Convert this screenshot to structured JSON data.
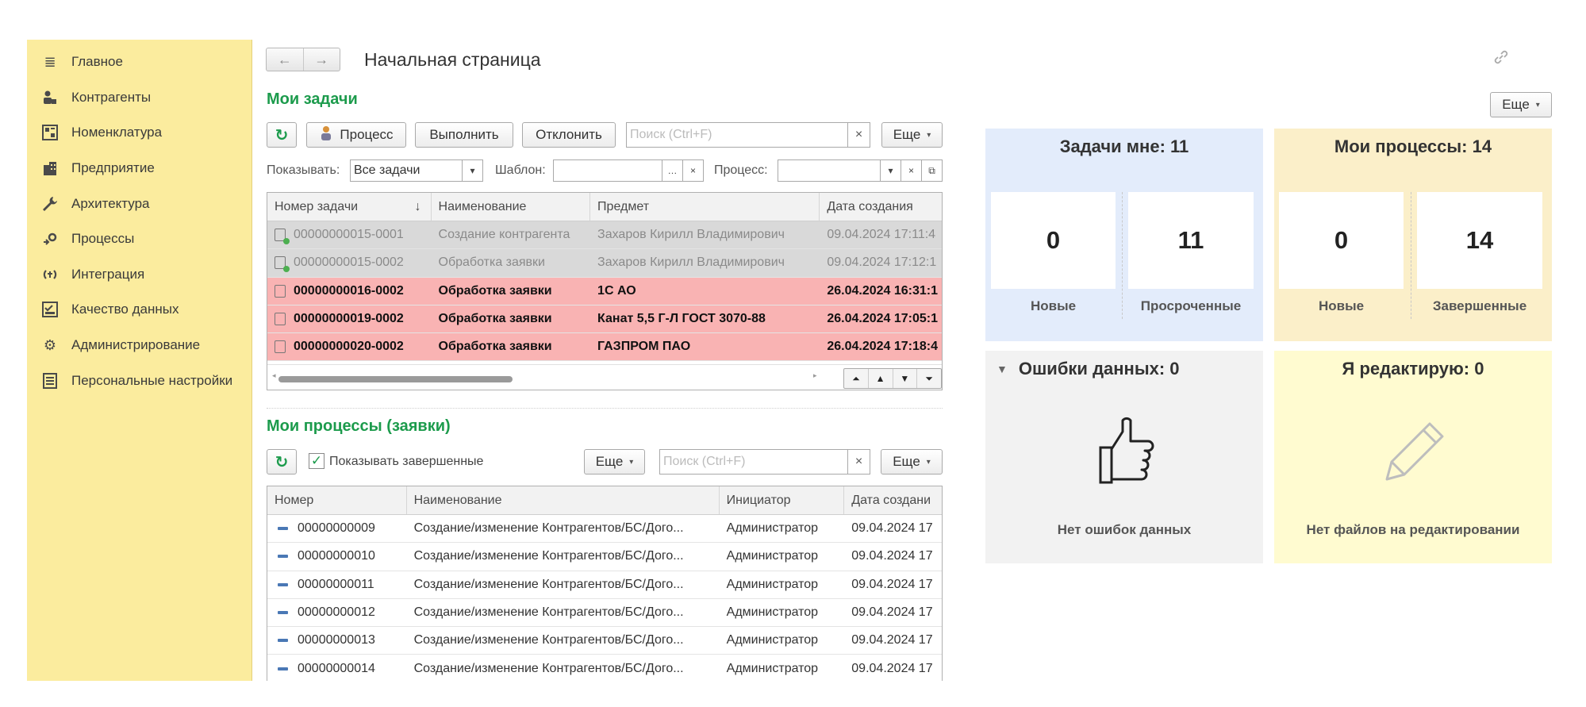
{
  "sidebar": {
    "items": [
      {
        "label": "Главное",
        "icon": "menu-lines-icon"
      },
      {
        "label": "Контрагенты",
        "icon": "people-icon"
      },
      {
        "label": "Номенклатура",
        "icon": "catalog-icon"
      },
      {
        "label": "Предприятие",
        "icon": "building-icon"
      },
      {
        "label": "Архитектура",
        "icon": "wrench-icon"
      },
      {
        "label": "Процессы",
        "icon": "process-icon"
      },
      {
        "label": "Интеграция",
        "icon": "sync-icon"
      },
      {
        "label": "Качество данных",
        "icon": "quality-icon"
      },
      {
        "label": "Администрирование",
        "icon": "gear-icon"
      },
      {
        "label": "Персональные настройки",
        "icon": "settings-list-icon"
      }
    ]
  },
  "header": {
    "title": "Начальная страница"
  },
  "tasks": {
    "title": "Мои задачи",
    "process_btn": "Процесс",
    "execute_btn": "Выполнить",
    "reject_btn": "Отклонить",
    "search_placeholder": "Поиск (Ctrl+F)",
    "more_btn": "Еще",
    "filter": {
      "show_label": "Показывать:",
      "show_value": "Все задачи",
      "template_label": "Шаблон:",
      "template_value": "",
      "process_label": "Процесс:",
      "process_value": ""
    },
    "columns": [
      "Номер задачи",
      "Наименование",
      "Предмет",
      "Дата создания"
    ],
    "rows": [
      {
        "style": "gray",
        "number": "00000000015-0001",
        "name": "Создание контрагента",
        "subject": "Захаров Кирилл Владимирович",
        "date": "09.04.2024 17:11:4"
      },
      {
        "style": "gray",
        "number": "00000000015-0002",
        "name": "Обработка заявки",
        "subject": "Захаров Кирилл Владимирович",
        "date": "09.04.2024 17:12:1"
      },
      {
        "style": "red",
        "number": "00000000016-0002",
        "name": "Обработка заявки",
        "subject": "1С АО",
        "date": "26.04.2024 16:31:1"
      },
      {
        "style": "red",
        "number": "00000000019-0002",
        "name": "Обработка заявки",
        "subject": "Канат 5,5 Г-Л ГОСТ 3070-88",
        "date": "26.04.2024 17:05:1"
      },
      {
        "style": "red",
        "number": "00000000020-0002",
        "name": "Обработка заявки",
        "subject": "ГАЗПРОМ ПАО",
        "date": "26.04.2024 17:18:4"
      }
    ]
  },
  "processes": {
    "title": "Мои процессы (заявки)",
    "show_completed_label": "Показывать завершенные",
    "show_completed_checked": true,
    "more_btn": "Еще",
    "search_placeholder": "Поиск (Ctrl+F)",
    "more_btn2": "Еще",
    "columns": [
      "Номер",
      "Наименование",
      "Инициатор",
      "Дата создани"
    ],
    "rows": [
      {
        "number": "00000000009",
        "name": "Создание/изменение Контрагентов/БС/Дого...",
        "initiator": "Администратор",
        "date": "09.04.2024 17"
      },
      {
        "number": "00000000010",
        "name": "Создание/изменение Контрагентов/БС/Дого...",
        "initiator": "Администратор",
        "date": "09.04.2024 17"
      },
      {
        "number": "00000000011",
        "name": "Создание/изменение Контрагентов/БС/Дого...",
        "initiator": "Администратор",
        "date": "09.04.2024 17"
      },
      {
        "number": "00000000012",
        "name": "Создание/изменение Контрагентов/БС/Дого...",
        "initiator": "Администратор",
        "date": "09.04.2024 17"
      },
      {
        "number": "00000000013",
        "name": "Создание/изменение Контрагентов/БС/Дого...",
        "initiator": "Администратор",
        "date": "09.04.2024 17"
      },
      {
        "number": "00000000014",
        "name": "Создание/изменение Контрагентов/БС/Дого...",
        "initiator": "Администратор",
        "date": "09.04.2024 17"
      }
    ]
  },
  "right": {
    "more_btn": "Еще",
    "tasks_panel": {
      "title": "Задачи мне: 11",
      "new_value": "0",
      "new_label": "Новые",
      "overdue_value": "11",
      "overdue_label": "Просроченные"
    },
    "processes_panel": {
      "title": "Мои процессы: 14",
      "new_value": "0",
      "new_label": "Новые",
      "done_value": "14",
      "done_label": "Завершенные"
    },
    "errors_panel": {
      "title": "Ошибки данных: 0",
      "message": "Нет ошибок данных"
    },
    "editing_panel": {
      "title": "Я редактирую: 0",
      "message": "Нет файлов на редактировании"
    }
  },
  "colors": {
    "sidebar_bg": "#fbec9e",
    "accent_green": "#1c9b4c",
    "panel_blue": "#e3ecfb",
    "panel_orange": "#fbefc9",
    "panel_gray": "#f2f2f2",
    "panel_yellow": "#fffbd0",
    "row_red": "#f9b3b3",
    "row_gray": "#d9d9d9"
  }
}
